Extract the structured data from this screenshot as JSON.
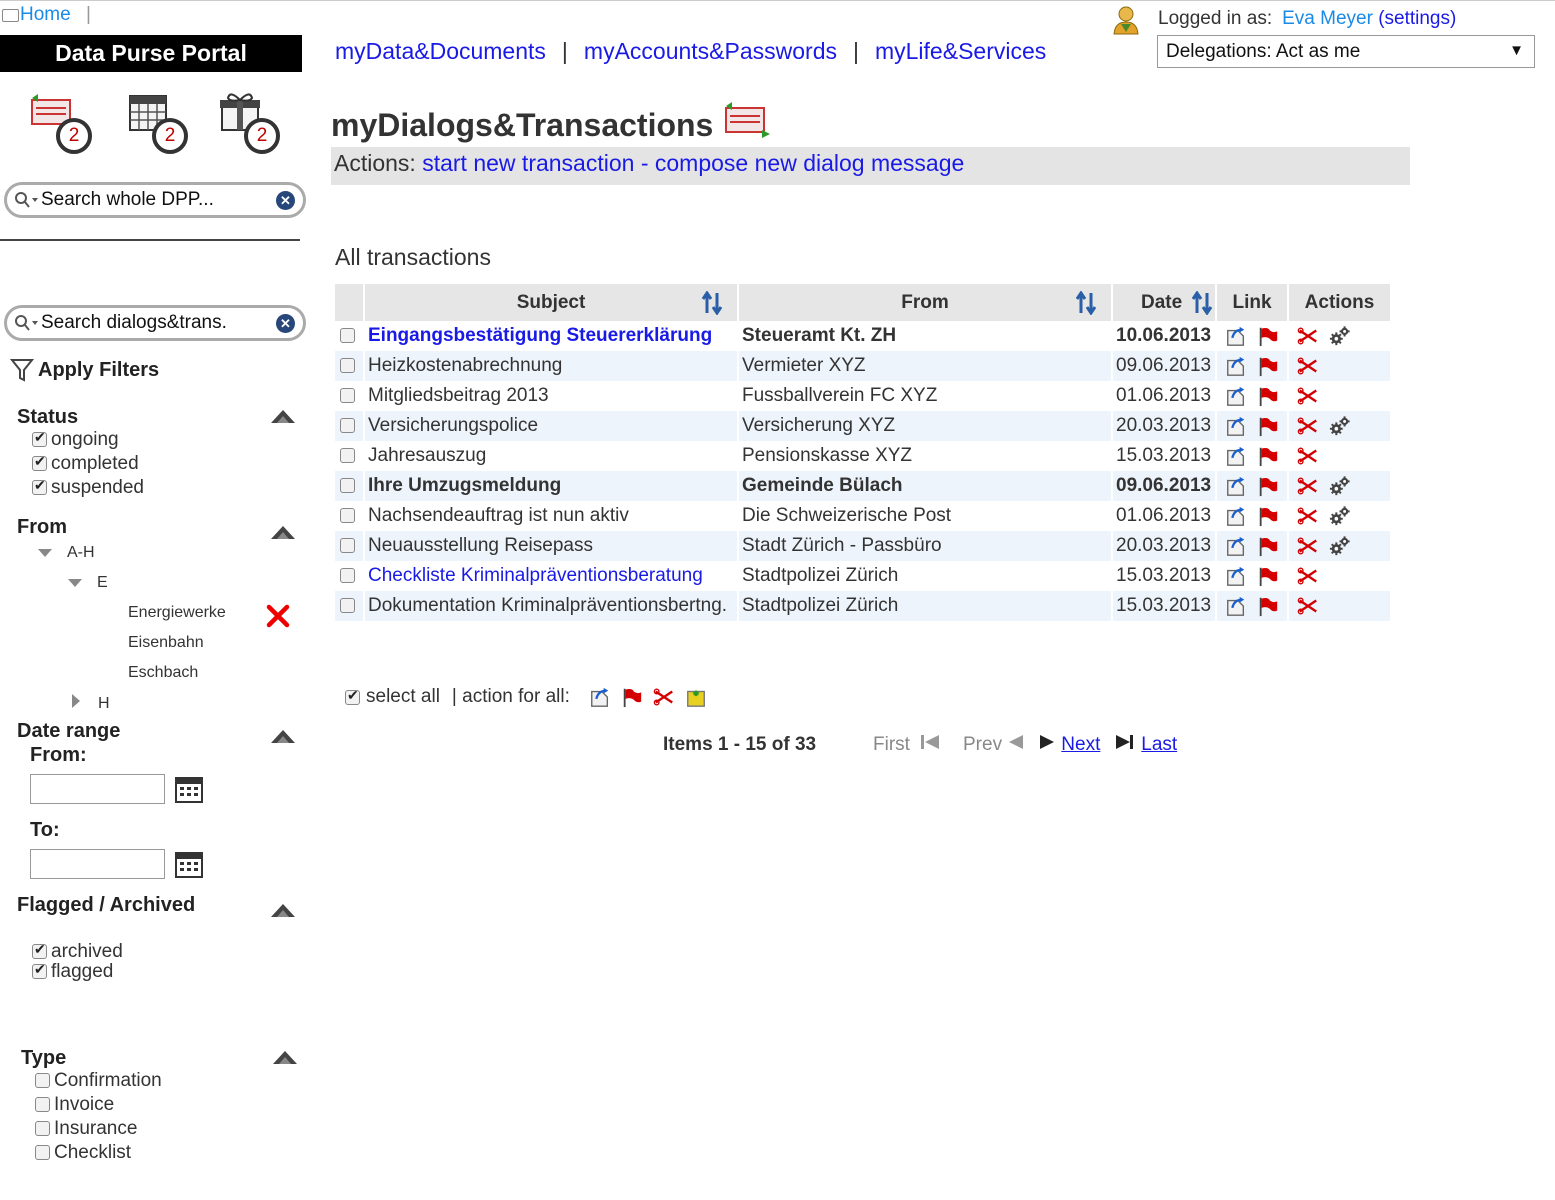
{
  "header": {
    "home_label": "Home",
    "home_separator": "|",
    "brand": "Data Purse Portal",
    "nav": [
      {
        "label": "myData&Documents"
      },
      {
        "label": "myAccounts&Passwords"
      },
      {
        "label": "myLife&Services"
      }
    ],
    "nav_separator": "|",
    "logged_in_label": "Logged in as:",
    "user_name": "Eva Meyer",
    "settings_label": "(settings)",
    "delegation_value": "Delegations: Act as me"
  },
  "sidebar": {
    "shortcuts": [
      {
        "icon": "transactions-icon",
        "count": "2"
      },
      {
        "icon": "calendar-icon",
        "count": "2"
      },
      {
        "icon": "gift-icon",
        "count": "2"
      }
    ],
    "global_search_placeholder": "Search whole DPP...",
    "local_search_placeholder": "Search dialogs&trans.",
    "apply_filters_label": "Apply Filters",
    "status": {
      "title": "Status",
      "options": [
        {
          "label": "ongoing",
          "checked": true
        },
        {
          "label": "completed",
          "checked": true
        },
        {
          "label": "suspended",
          "checked": true
        }
      ]
    },
    "from": {
      "title": "From",
      "group": "A-H",
      "subgroup": "E",
      "entries": [
        "Energiewerke",
        "Eisenbahn",
        "Eschbach"
      ],
      "next_group": "H"
    },
    "date_range": {
      "title": "Date range",
      "from_label": "From:",
      "to_label": "To:",
      "from_value": "",
      "to_value": ""
    },
    "flagged_archived": {
      "title": "Flagged / Archived",
      "options": [
        {
          "label": "archived",
          "checked": true
        },
        {
          "label": "flagged",
          "checked": true
        }
      ]
    },
    "type": {
      "title": "Type",
      "options": [
        {
          "label": "Confirmation",
          "checked": false
        },
        {
          "label": "Invoice",
          "checked": false
        },
        {
          "label": "Insurance",
          "checked": false
        },
        {
          "label": "Checklist",
          "checked": false
        }
      ]
    }
  },
  "main": {
    "title": "myDialogs&Transactions",
    "actions_prefix": "Actions:",
    "action_start": "start new transaction",
    "action_dash": "-",
    "action_compose": "compose new dialog message",
    "section_title": "All transactions",
    "columns": {
      "subject": "Subject",
      "from": "From",
      "date": "Date",
      "link": "Link",
      "actions": "Actions"
    },
    "rows": [
      {
        "subject": "Eingangsbestätigung Steuererklärung",
        "from": "Steueramt Kt. ZH",
        "date": "10.06.2013",
        "unread": true,
        "link_style": true,
        "gears": true
      },
      {
        "subject": "Heizkostenabrechnung",
        "from": "Vermieter XYZ",
        "date": "09.06.2013",
        "unread": false,
        "link_style": false,
        "gears": false
      },
      {
        "subject": "Mitgliedsbeitrag 2013",
        "from": "Fussballverein FC XYZ",
        "date": "01.06.2013",
        "unread": false,
        "link_style": false,
        "gears": false
      },
      {
        "subject": "Versicherungspolice",
        "from": "Versicherung XYZ",
        "date": "20.03.2013",
        "unread": false,
        "link_style": false,
        "gears": true
      },
      {
        "subject": "Jahresauszug",
        "from": "Pensionskasse XYZ",
        "date": "15.03.2013",
        "unread": false,
        "link_style": false,
        "gears": false
      },
      {
        "subject": "Ihre Umzugsmeldung",
        "from": "Gemeinde Bülach",
        "date": "09.06.2013",
        "unread": true,
        "link_style": false,
        "gears": true
      },
      {
        "subject": "Nachsendeauftrag ist nun aktiv",
        "from": "Die Schweizerische Post",
        "date": "01.06.2013",
        "unread": false,
        "link_style": false,
        "gears": true
      },
      {
        "subject": "Neuausstellung Reisepass",
        "from": "Stadt Zürich - Passbüro",
        "date": "20.03.2013",
        "unread": false,
        "link_style": false,
        "gears": true
      },
      {
        "subject": "Checkliste Kriminalpräventionsberatung",
        "from": "Stadtpolizei Zürich",
        "date": "15.03.2013",
        "unread": false,
        "link_style": true,
        "gears": false
      },
      {
        "subject": "Dokumentation Kriminalpräventionsbertng.",
        "from": "Stadtpolizei Zürich",
        "date": "15.03.2013",
        "unread": false,
        "link_style": false,
        "gears": false
      }
    ],
    "select_all_label": "select all",
    "action_for_all_label": "| action for all:",
    "pager": {
      "summary": "Items 1 - 15 of 33",
      "first": "First",
      "prev": "Prev",
      "next": "Next",
      "last": "Last"
    }
  },
  "colors": {
    "link": "#1a1ae6",
    "brand_bg": "#000000",
    "row_alt": "#eef4fb",
    "header_bg": "#e6e6e6",
    "flag": "#d40000",
    "sort_blue": "#2a5fa8"
  }
}
